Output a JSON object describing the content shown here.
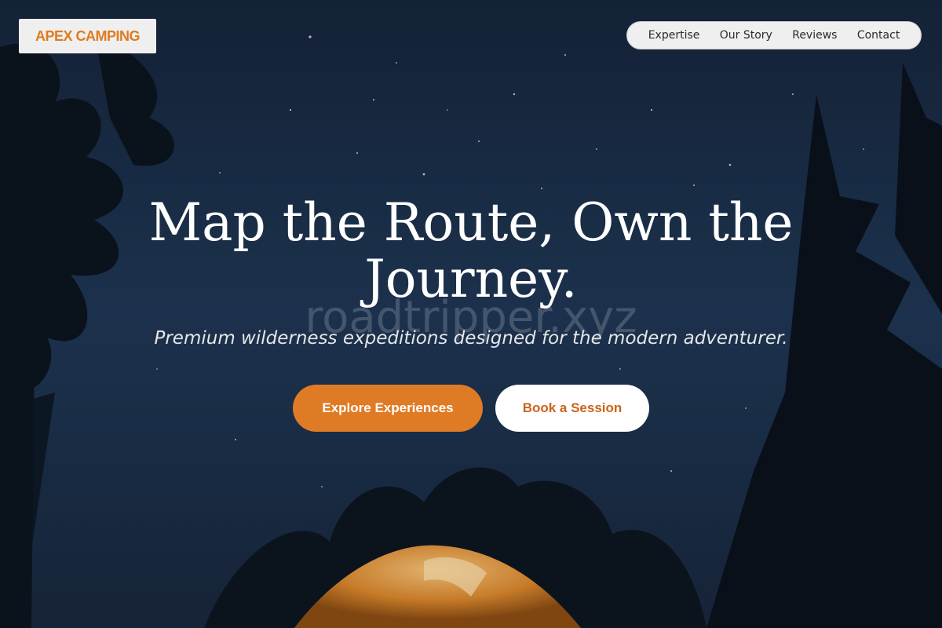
{
  "brand": {
    "name": "APEX CAMPING",
    "color": "#e07b1f"
  },
  "nav": {
    "items": [
      {
        "label": "Expertise"
      },
      {
        "label": "Our Story"
      },
      {
        "label": "Reviews"
      },
      {
        "label": "Contact"
      }
    ]
  },
  "hero": {
    "title": "Map the Route, Own the Journey.",
    "watermark": "roadtripper.xyz",
    "subtitle": "Premium wilderness expeditions designed for the modern adventurer.",
    "primary_cta": "Explore Experiences",
    "secondary_cta": "Book a Session"
  },
  "colors": {
    "accent": "#e07b25",
    "sky": "#1e3350",
    "tent": "#d98a2e"
  }
}
